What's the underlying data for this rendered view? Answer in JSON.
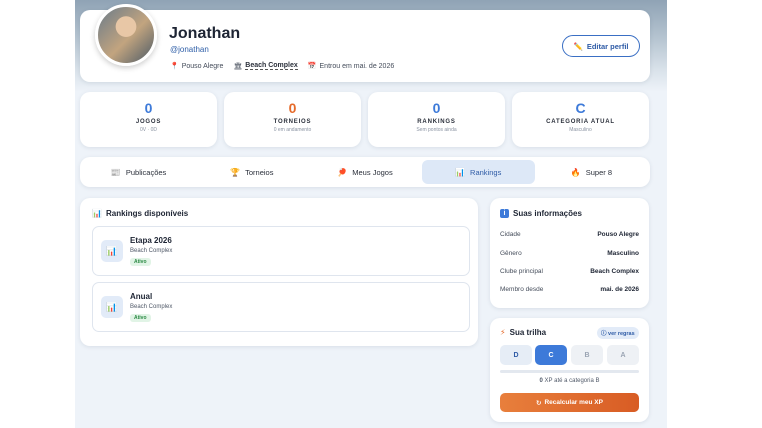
{
  "profile": {
    "name": "Jonathan",
    "handle": "@jonathan",
    "city": "Pouso Alegre",
    "club": "Beach Complex",
    "joined": "Entrou em mai. de 2026",
    "edit_label": "Editar perfil"
  },
  "stats": [
    {
      "value": "0",
      "label": "JOGOS",
      "sub": "0V · 0D",
      "color": "#3d7ad9"
    },
    {
      "value": "0",
      "label": "TORNEIOS",
      "sub": "0 em andamento",
      "color": "#e56a2a"
    },
    {
      "value": "0",
      "label": "RANKINGS",
      "sub": "Sem pontos ainda",
      "color": "#3d7ad9"
    },
    {
      "value": "C",
      "label": "CATEGORIA ATUAL",
      "sub": "Masculino",
      "color": "#3d7ad9"
    }
  ],
  "tabs": [
    {
      "label": "Publicações",
      "icon": "newspaper-icon"
    },
    {
      "label": "Torneios",
      "icon": "trophy-icon"
    },
    {
      "label": "Meus Jogos",
      "icon": "racket-icon"
    },
    {
      "label": "Rankings",
      "icon": "bar-chart-icon",
      "active": true
    },
    {
      "label": "Super 8",
      "icon": "fire-icon"
    }
  ],
  "rankings": {
    "title": "Rankings disponíveis",
    "items": [
      {
        "name": "Etapa 2026",
        "club": "Beach Complex",
        "status": "Ativo"
      },
      {
        "name": "Anual",
        "club": "Beach Complex",
        "status": "Ativo"
      }
    ]
  },
  "info": {
    "title": "Suas informações",
    "rows": [
      {
        "label": "Cidade",
        "value": "Pouso Alegre"
      },
      {
        "label": "Gênero",
        "value": "Masculino"
      },
      {
        "label": "Clube principal",
        "value": "Beach Complex"
      },
      {
        "label": "Membro desde",
        "value": "mai. de 2026"
      }
    ]
  },
  "trail": {
    "title": "Sua trilha",
    "rules_label": "ver regras",
    "levels": [
      "D",
      "C",
      "B",
      "A"
    ],
    "active_level": "C",
    "progress": 0,
    "xp_value": "0",
    "xp_text": " XP até a categoria B",
    "recalc_label": "Recalcular meu XP"
  }
}
